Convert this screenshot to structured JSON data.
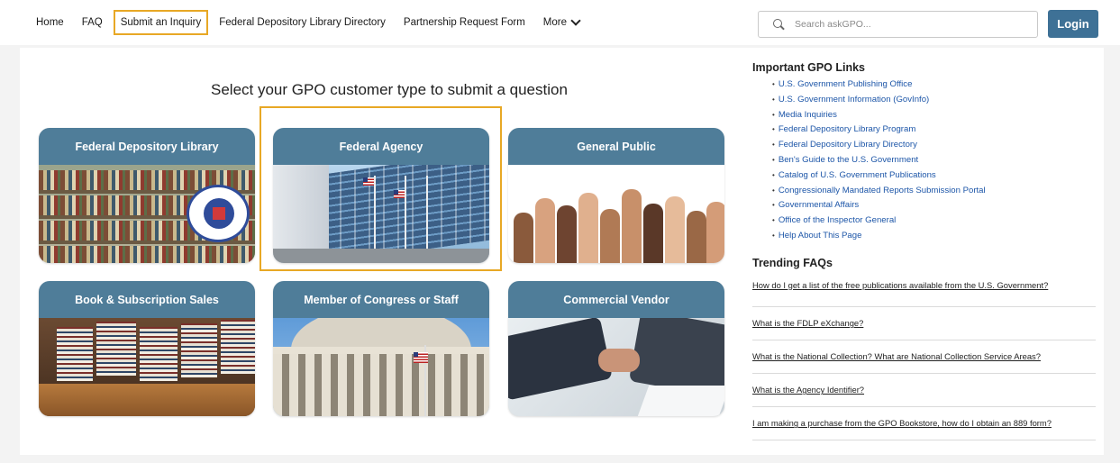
{
  "nav": {
    "items": [
      {
        "label": "Home"
      },
      {
        "label": "FAQ"
      },
      {
        "label": "Submit an Inquiry",
        "active": true
      },
      {
        "label": "Federal Depository Library Directory"
      },
      {
        "label": "Partnership Request Form"
      }
    ],
    "more_label": "More"
  },
  "search": {
    "placeholder": "Search askGPO..."
  },
  "login_label": "Login",
  "main": {
    "heading": "Select your GPO customer type to submit a question",
    "cards": [
      {
        "title": "Federal Depository Library"
      },
      {
        "title": "Federal Agency",
        "highlighted": true
      },
      {
        "title": "General Public"
      },
      {
        "title": "Book & Subscription Sales"
      },
      {
        "title": "Member of Congress or Staff"
      },
      {
        "title": "Commercial Vendor"
      }
    ]
  },
  "sidebar": {
    "links_heading": "Important GPO Links",
    "links": [
      "U.S. Government Publishing Office",
      "U.S. Government Information (GovInfo)",
      "Media Inquiries",
      "Federal Depository Library Program",
      "Federal Depository Library Directory",
      "Ben's Guide to the U.S. Government",
      "Catalog of U.S. Government Publications",
      "Congressionally Mandated Reports Submission Portal",
      "Governmental Affairs",
      "Office of the Inspector General",
      "Help About This Page"
    ],
    "faq_heading": "Trending FAQs",
    "faqs": [
      "How do I get a list of the free publications available from the U.S. Government?",
      "What is the FDLP eXchange?",
      "What is the National Collection? What are National Collection Service Areas?",
      "What is the Agency Identifier?",
      "I am making a purchase from the GPO Bookstore, how do I obtain an 889 form?"
    ]
  },
  "colors": {
    "accent_highlight": "#e8a825",
    "card_header": "#4f7d99",
    "login_button": "#3e7196",
    "link": "#1d56a8"
  }
}
